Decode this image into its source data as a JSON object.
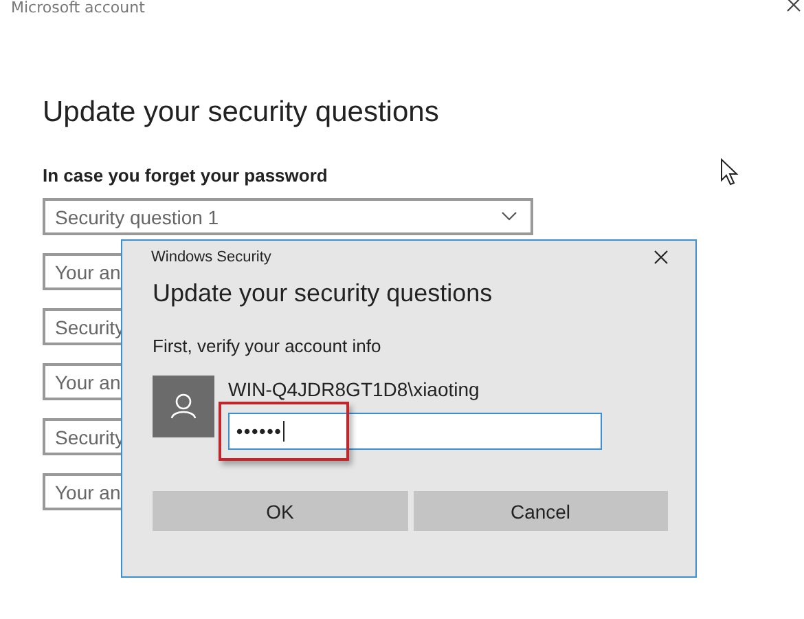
{
  "window": {
    "title": "Microsoft account"
  },
  "page": {
    "heading": "Update your security questions",
    "subheading": "In case you forget your password",
    "fields": [
      {
        "kind": "dropdown",
        "text": "Security question 1",
        "chevron": true
      },
      {
        "kind": "text",
        "text": "Your an"
      },
      {
        "kind": "dropdown",
        "text": "Security"
      },
      {
        "kind": "text",
        "text": "Your an"
      },
      {
        "kind": "dropdown",
        "text": "Security"
      },
      {
        "kind": "text",
        "text": "Your an"
      }
    ]
  },
  "dialog": {
    "title": "Windows Security",
    "heading": "Update your security questions",
    "prompt": "First, verify your account info",
    "username": "WIN-Q4JDR8GT1D8\\xiaoting",
    "password": {
      "value": "••••••",
      "highlighted": true
    },
    "buttons": [
      "OK",
      "Cancel"
    ]
  }
}
